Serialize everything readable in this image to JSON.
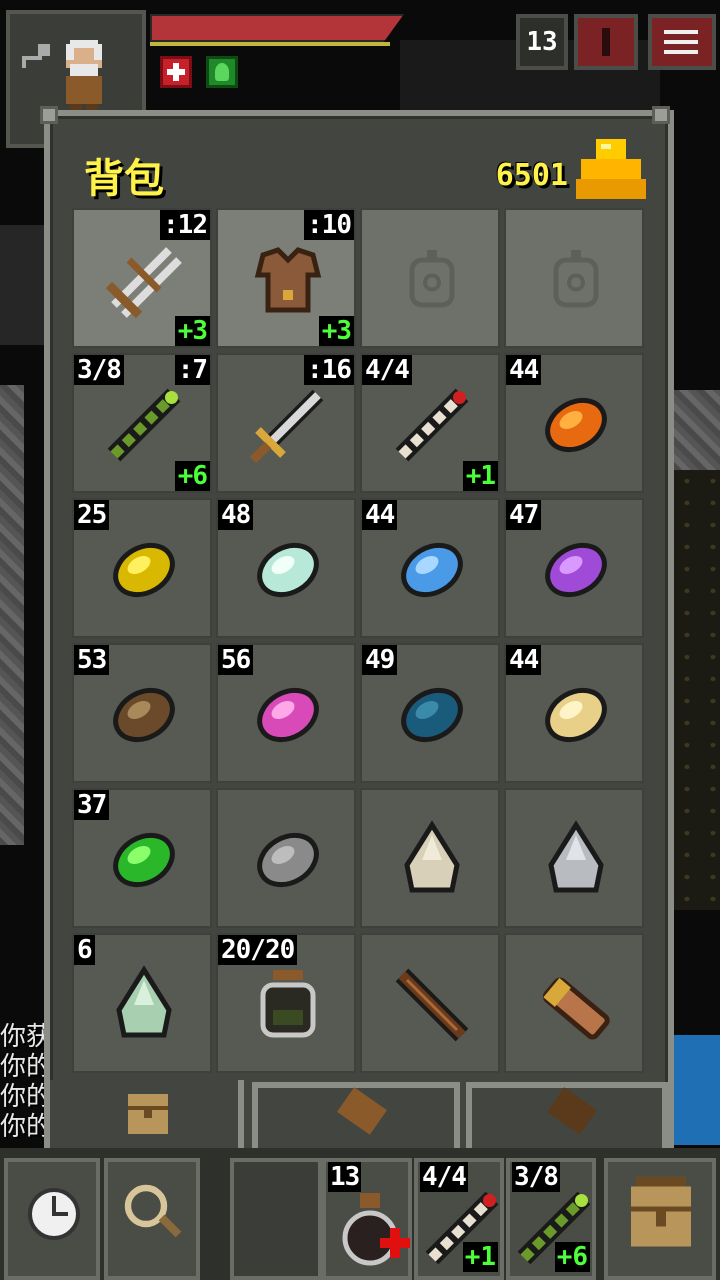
{
  "status": {
    "depth": "13",
    "buffs": [
      "healing-buff-icon",
      "herb-buff-icon"
    ]
  },
  "inventory": {
    "title": "背包",
    "gold": "6501",
    "slots": [
      {
        "name": "crossbow",
        "qty": "",
        "lvl": ":12",
        "upg": "+3",
        "icon": "crossbow-icon",
        "equipped": true
      },
      {
        "name": "leather-armor",
        "qty": "",
        "lvl": ":10",
        "upg": "+3",
        "icon": "leather-armor-icon",
        "equipped": true
      },
      {
        "name": "empty-ring-slot",
        "qty": "",
        "lvl": "",
        "upg": "",
        "icon": "empty-ring-slot-icon",
        "equipped": true,
        "empty": true
      },
      {
        "name": "empty-artifact-slot",
        "qty": "",
        "lvl": "",
        "upg": "",
        "icon": "empty-artifact-slot-icon",
        "equipped": true,
        "empty": true
      },
      {
        "name": "wand-green",
        "qty": "3/8",
        "lvl": ":7",
        "upg": "+6",
        "icon": "wand-green-icon"
      },
      {
        "name": "shortsword",
        "qty": "",
        "lvl": ":16",
        "upg": "",
        "icon": "sword-icon"
      },
      {
        "name": "wand-striped",
        "qty": "4/4",
        "lvl": "",
        "upg": "+1",
        "icon": "wand-striped-icon"
      },
      {
        "name": "seed-orange",
        "qty": "44",
        "lvl": "",
        "upg": "",
        "icon": "seed-orange-icon"
      },
      {
        "name": "seed-yellow",
        "qty": "25",
        "lvl": "",
        "upg": "",
        "icon": "seed-yellow-icon"
      },
      {
        "name": "seed-mint",
        "qty": "48",
        "lvl": "",
        "upg": "",
        "icon": "seed-mint-icon"
      },
      {
        "name": "seed-blue",
        "qty": "44",
        "lvl": "",
        "upg": "",
        "icon": "seed-blue-icon"
      },
      {
        "name": "seed-purple",
        "qty": "47",
        "lvl": "",
        "upg": "",
        "icon": "seed-purple-icon"
      },
      {
        "name": "seed-brown",
        "qty": "53",
        "lvl": "",
        "upg": "",
        "icon": "seed-brown-icon"
      },
      {
        "name": "seed-pink",
        "qty": "56",
        "lvl": "",
        "upg": "",
        "icon": "seed-pink-icon"
      },
      {
        "name": "seed-teal",
        "qty": "49",
        "lvl": "",
        "upg": "",
        "icon": "seed-teal-icon"
      },
      {
        "name": "seed-cream",
        "qty": "44",
        "lvl": "",
        "upg": "",
        "icon": "seed-cream-icon"
      },
      {
        "name": "seed-green",
        "qty": "37",
        "lvl": "",
        "upg": "",
        "icon": "seed-green-icon"
      },
      {
        "name": "stone-gray",
        "qty": "",
        "lvl": "",
        "upg": "",
        "icon": "stone-gray-icon"
      },
      {
        "name": "runestone-beige",
        "qty": "",
        "lvl": "",
        "upg": "",
        "icon": "runestone-beige-icon"
      },
      {
        "name": "runestone-silver",
        "qty": "",
        "lvl": "",
        "upg": "",
        "icon": "runestone-silver-icon"
      },
      {
        "name": "runestone-green",
        "qty": "6",
        "lvl": "",
        "upg": "",
        "icon": "runestone-green-icon"
      },
      {
        "name": "dew-vial",
        "qty": "20/20",
        "lvl": "",
        "upg": "",
        "icon": "dew-vial-icon"
      },
      {
        "name": "staff-dark",
        "qty": "",
        "lvl": "",
        "upg": "",
        "icon": "staff-icon"
      },
      {
        "name": "scroll-holder",
        "qty": "",
        "lvl": "",
        "upg": "",
        "icon": "scroll-holder-icon"
      }
    ]
  },
  "log": [
    "你获",
    "你的",
    "你的",
    "你的"
  ],
  "quickslots": [
    {
      "qty": "13",
      "upg": "",
      "icon": "healing-potion-icon"
    },
    {
      "qty": "4/4",
      "upg": "+1",
      "icon": "wand-striped-icon"
    },
    {
      "qty": "3/8",
      "upg": "+6",
      "icon": "wand-green-icon"
    }
  ],
  "colors": {
    "gold_text": "#fff34a",
    "upgrade_text": "#4cff3a",
    "hp": "#b3353a"
  }
}
